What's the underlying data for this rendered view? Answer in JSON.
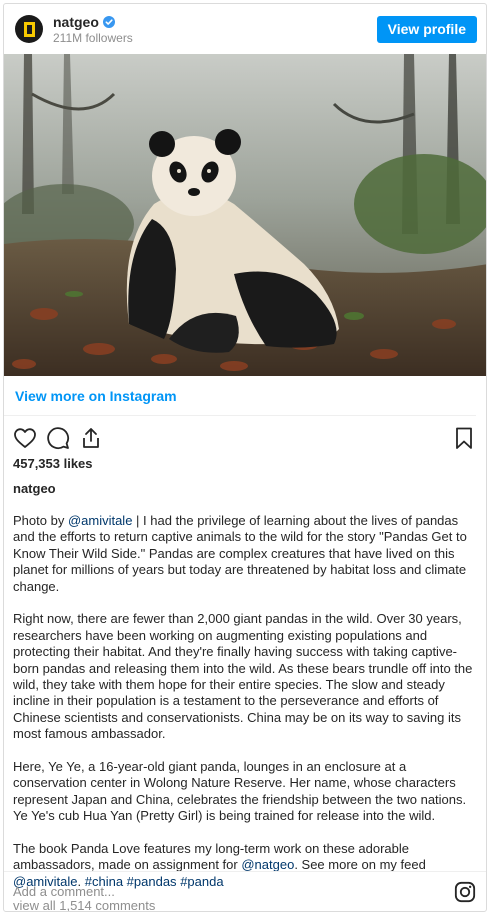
{
  "header": {
    "username": "natgeo",
    "followers": "211M followers",
    "view_profile_label": "View profile"
  },
  "photo": {
    "description_icon": "photo"
  },
  "view_more_label": "View more on Instagram",
  "likes": "457,353 likes",
  "owner": "natgeo",
  "caption": {
    "p1_prefix": "Photo by ",
    "p1_mention": "@amivitale",
    "p1_rest": " | I had the privilege of learning about the lives of pandas and the efforts to return captive animals to the wild for the story \"Pandas Get to Know Their Wild Side.\" Pandas are complex creatures that have lived on this planet for millions of years but today are threatened by habitat loss and climate change.",
    "p2": "Right now, there are fewer than 2,000 giant pandas in the wild. Over 30 years, researchers have been working on augmenting existing populations and protecting their habitat. And they're finally having success with taking captive-born pandas and releasing them into the wild. As these bears trundle off into the wild, they take with them hope for their entire species. The slow and steady incline in their population is a testament to the perseverance and efforts of Chinese scientists and conservationists. China may be on its way to saving its most famous ambassador.",
    "p3": "Here, Ye Ye, a 16-year-old giant panda, lounges in an enclosure at a conservation center in Wolong Nature Reserve. Her name, whose characters represent Japan and China, celebrates the friendship between the two nations. Ye Ye's cub Hua Yan (Pretty Girl) is being trained for release into the wild.",
    "p4_a": "The book Panda Love features my long-term work on these adorable ambassadors, made on assignment for ",
    "p4_mention1": "@natgeo",
    "p4_b": ". See more on my feed ",
    "p4_mention2": "@amivitale",
    "p4_c": ". ",
    "p4_tag1": "#china",
    "p4_tag2": "#pandas",
    "p4_tag3": "#panda"
  },
  "comments_link": "view all 1,514 comments",
  "add_comment_placeholder": "Add a comment...",
  "colors": {
    "accent": "#0095f6",
    "link": "#00376b",
    "muted": "#8e8e8e",
    "border": "#dbdbdb"
  }
}
